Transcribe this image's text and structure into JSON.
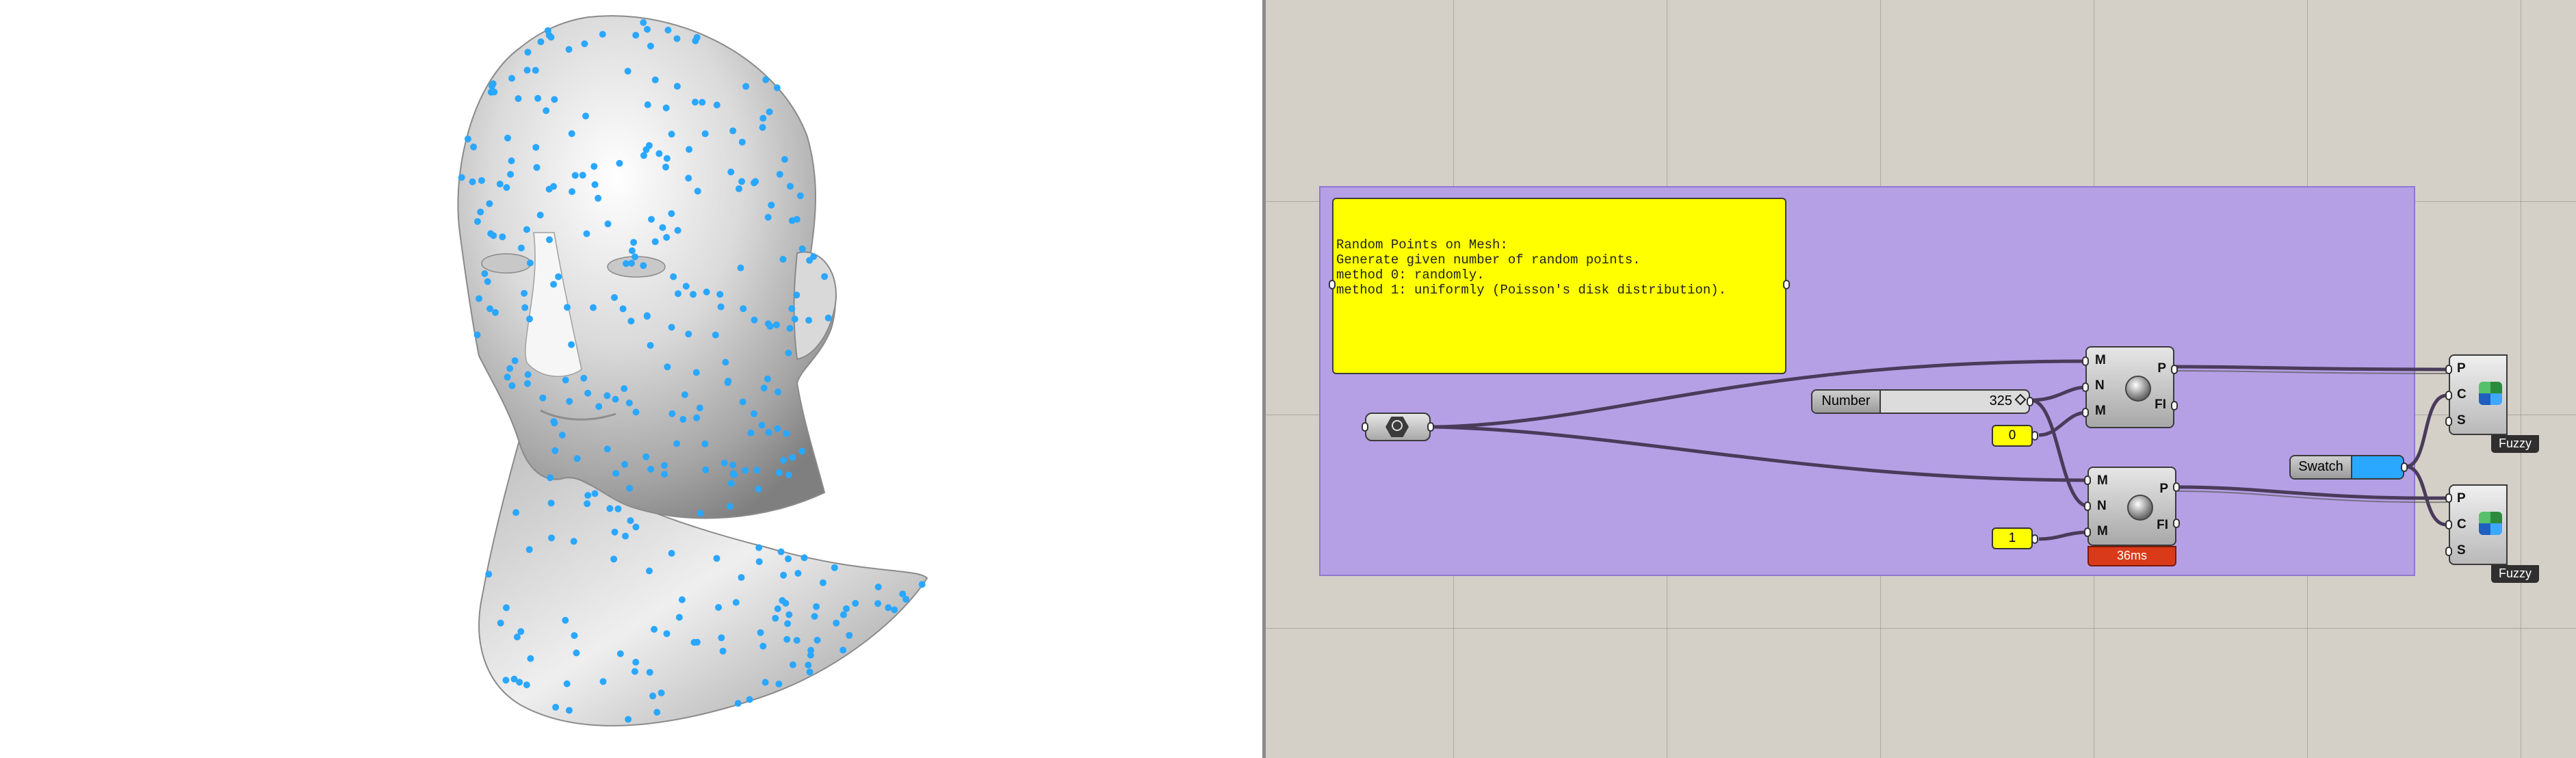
{
  "panel": {
    "lines": [
      "Random Points on Mesh:",
      "",
      "Generate given number of random points.",
      "",
      "method 0: randomly.",
      "method 1: uniformly (Poisson's disk distribution)."
    ]
  },
  "component_top": {
    "inputs": [
      "M",
      "N",
      "M"
    ],
    "outputs": [
      "P",
      "FI"
    ]
  },
  "component_bottom": {
    "inputs": [
      "M",
      "N",
      "M"
    ],
    "outputs": [
      "P",
      "FI"
    ],
    "timer": "36ms"
  },
  "number_slider": {
    "label": "Number",
    "value": "325"
  },
  "method_top": {
    "value": "0"
  },
  "method_bottom": {
    "value": "1"
  },
  "swatch": {
    "label": "Swatch",
    "color": "#2aa7ff"
  },
  "preview_top": {
    "inputs": [
      "P",
      "C",
      "S"
    ],
    "tag": "Fuzzy"
  },
  "preview_bottom": {
    "inputs": [
      "P",
      "C",
      "S"
    ],
    "tag": "Fuzzy"
  },
  "colors": {
    "group_fill": "#b5a0e6",
    "panel_fill": "#ffff00",
    "point_color": "#2aa7ff",
    "timer_fill": "#d93a1a"
  }
}
